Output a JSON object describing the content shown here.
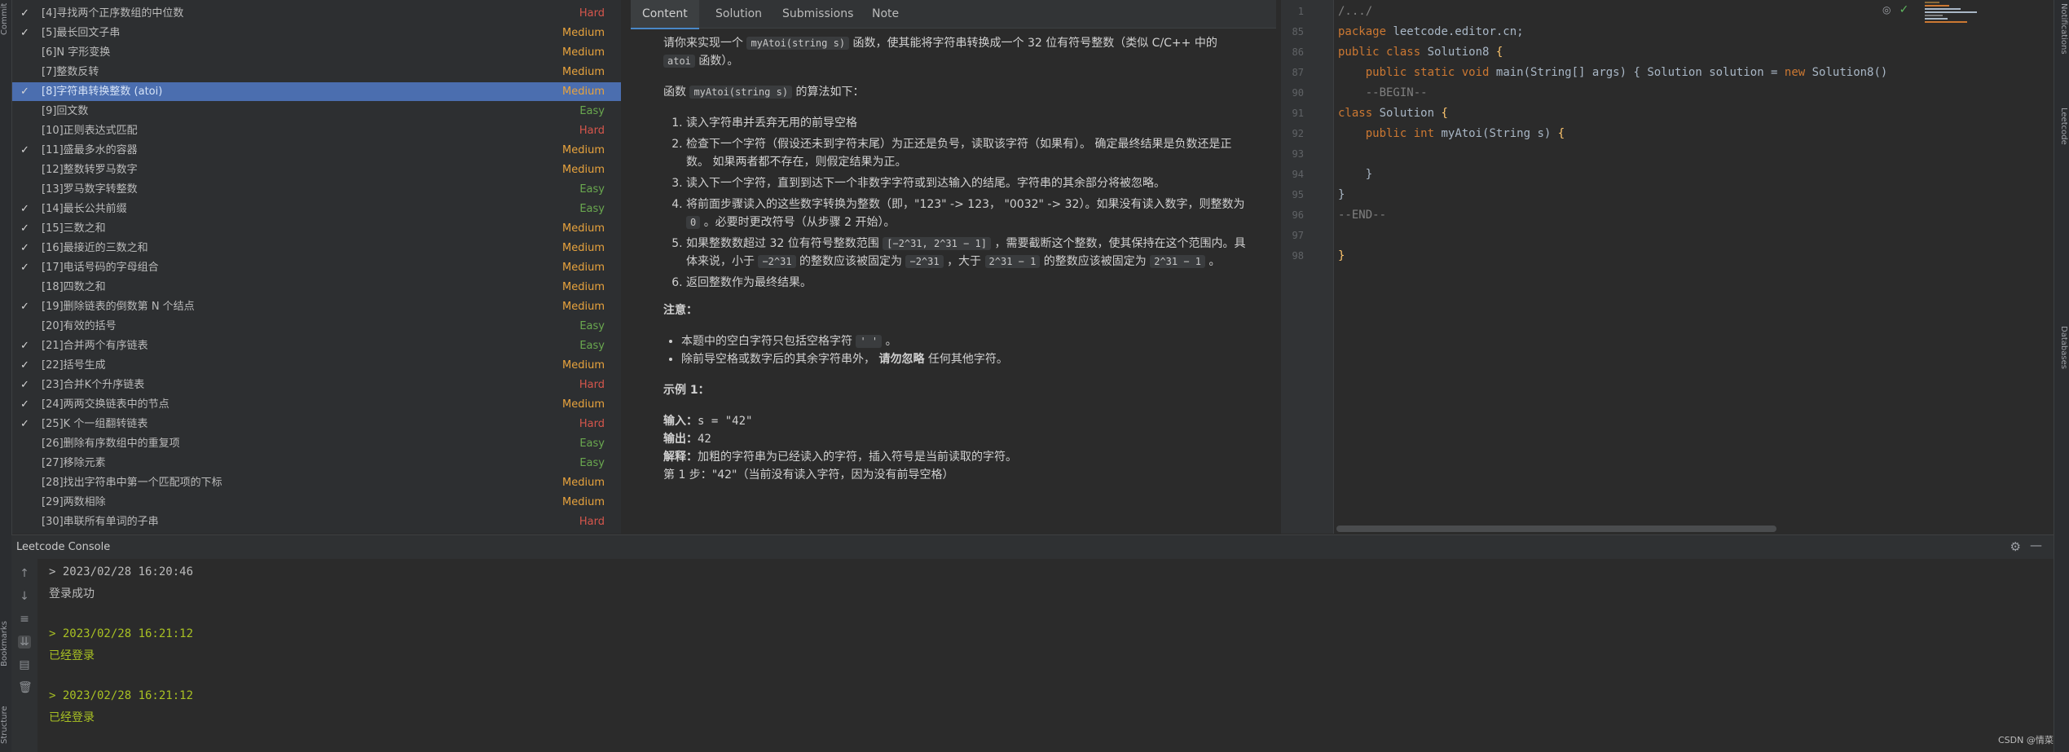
{
  "left_strip": {
    "labels": [
      "Commit",
      "Bookmarks",
      "Structure"
    ]
  },
  "right_strip": {
    "labels": [
      "Notifications",
      "Leetcode",
      "Databases"
    ]
  },
  "problems": [
    {
      "check": "✓",
      "title": "[4]寻找两个正序数组的中位数",
      "difficulty": "Hard",
      "level": "hard"
    },
    {
      "check": "✓",
      "title": "[5]最长回文子串",
      "difficulty": "Medium",
      "level": "medium"
    },
    {
      "check": "",
      "title": "[6]N 字形变换",
      "difficulty": "Medium",
      "level": "medium"
    },
    {
      "check": "",
      "title": "[7]整数反转",
      "difficulty": "Medium",
      "level": "medium"
    },
    {
      "check": "✓",
      "title": "[8]字符串转换整数 (atoi)",
      "difficulty": "Medium",
      "level": "medium",
      "selected": true
    },
    {
      "check": "",
      "title": "[9]回文数",
      "difficulty": "Easy",
      "level": "easy"
    },
    {
      "check": "",
      "title": "[10]正则表达式匹配",
      "difficulty": "Hard",
      "level": "hard"
    },
    {
      "check": "✓",
      "title": "[11]盛最多水的容器",
      "difficulty": "Medium",
      "level": "medium"
    },
    {
      "check": "",
      "title": "[12]整数转罗马数字",
      "difficulty": "Medium",
      "level": "medium"
    },
    {
      "check": "",
      "title": "[13]罗马数字转整数",
      "difficulty": "Easy",
      "level": "easy"
    },
    {
      "check": "✓",
      "title": "[14]最长公共前缀",
      "difficulty": "Easy",
      "level": "easy"
    },
    {
      "check": "✓",
      "title": "[15]三数之和",
      "difficulty": "Medium",
      "level": "medium"
    },
    {
      "check": "✓",
      "title": "[16]最接近的三数之和",
      "difficulty": "Medium",
      "level": "medium"
    },
    {
      "check": "✓",
      "title": "[17]电话号码的字母组合",
      "difficulty": "Medium",
      "level": "medium"
    },
    {
      "check": "",
      "title": "[18]四数之和",
      "difficulty": "Medium",
      "level": "medium"
    },
    {
      "check": "✓",
      "title": "[19]删除链表的倒数第 N 个结点",
      "difficulty": "Medium",
      "level": "medium"
    },
    {
      "check": "",
      "title": "[20]有效的括号",
      "difficulty": "Easy",
      "level": "easy"
    },
    {
      "check": "✓",
      "title": "[21]合并两个有序链表",
      "difficulty": "Easy",
      "level": "easy"
    },
    {
      "check": "✓",
      "title": "[22]括号生成",
      "difficulty": "Medium",
      "level": "medium"
    },
    {
      "check": "✓",
      "title": "[23]合并K个升序链表",
      "difficulty": "Hard",
      "level": "hard"
    },
    {
      "check": "✓",
      "title": "[24]两两交换链表中的节点",
      "difficulty": "Medium",
      "level": "medium"
    },
    {
      "check": "✓",
      "title": "[25]K 个一组翻转链表",
      "difficulty": "Hard",
      "level": "hard"
    },
    {
      "check": "",
      "title": "[26]删除有序数组中的重复项",
      "difficulty": "Easy",
      "level": "easy"
    },
    {
      "check": "",
      "title": "[27]移除元素",
      "difficulty": "Easy",
      "level": "easy"
    },
    {
      "check": "",
      "title": "[28]找出字符串中第一个匹配项的下标",
      "difficulty": "Medium",
      "level": "medium"
    },
    {
      "check": "",
      "title": "[29]两数相除",
      "difficulty": "Medium",
      "level": "medium"
    },
    {
      "check": "",
      "title": "[30]串联所有单词的子串",
      "difficulty": "Hard",
      "level": "hard"
    }
  ],
  "tabs": [
    "Content",
    "Solution",
    "Submissions",
    "Note"
  ],
  "description": {
    "intro_a": "请你来实现一个",
    "func": "myAtoi(string s)",
    "intro_b": "函数，使其能将字符串转换成一个 32 位有符号整数（类似 C/C++ 中的",
    "atoi": "atoi",
    "intro_c": "函数）。",
    "algo_a": "函数",
    "algo_b": "的算法如下：",
    "step1": "读入字符串并丢弃无用的前导空格",
    "step2": "检查下一个字符（假设还未到字符末尾）为正还是负号，读取该字符（如果有）。 确定最终结果是负数还是正数。 如果两者都不存在，则假定结果为正。",
    "step3": "读入下一个字符，直到到达下一个非数字字符或到达输入的结尾。字符串的其余部分将被忽略。",
    "step4a": "将前面步骤读入的这些数字转换为整数（即，\"123\" -> 123， \"0032\" -> 32）。如果没有读入数字，则整数为",
    "step4_zero": "0",
    "step4b": "。必要时更改符号（从步骤 2 开始）。",
    "step5a": "如果整数数超过 32 位有符号整数范围",
    "step5_range": "[−2^31, 2^31 − 1]",
    "step5b": "，需要截断这个整数，使其保持在这个范围内。具体来说，小于",
    "step5_min": "−2^31",
    "step5c": "的整数应该被固定为",
    "step5_min2": "−2^31",
    "step5d": "，大于",
    "step5_max": "2^31 − 1",
    "step5e": "的整数应该被固定为",
    "step5_max2": "2^31 − 1",
    "step5f": "。",
    "step6": "返回整数作为最终结果。",
    "note_title": "注意：",
    "note1a": "本题中的空白字符只包括空格字符",
    "note1_code": "' '",
    "note1b": "。",
    "note2a": "除前导空格或数字后的其余字符串外，",
    "note2_bold": "请勿忽略",
    "note2b": " 任何其他字符。",
    "example_title": "示例 1：",
    "input_label": "输入：",
    "input_value": "s = \"42\"",
    "output_label": "输出：",
    "output_value": "42",
    "explain_label": "解释：",
    "explain_value": "加粗的字符串为已经读入的字符，插入符号是当前读取的字符。",
    "step_line": "第 1 步：\"42\"（当前没有读入字符，因为没有前导空格）"
  },
  "editor": {
    "line_numbers": [
      "1",
      "85",
      "86",
      "87",
      "90",
      "91",
      "92",
      "93",
      "94",
      "95",
      "96",
      "97",
      "98"
    ],
    "lines": [
      "/.../",
      "package leetcode.editor.cn;",
      "public class Solution8 {",
      "    public static void main(String[] args) { Solution solution = new Solution8()",
      "    --BEGIN--",
      "class Solution {",
      "    public int myAtoi(String s) {",
      "",
      "    }",
      "}",
      "--END--",
      "",
      "}"
    ]
  },
  "console": {
    "title": "Leetcode Console",
    "lines": [
      {
        "text": "> 2023/02/28 16:20:46",
        "style": "plain-mono"
      },
      {
        "text": "登录成功",
        "style": "plain"
      },
      {
        "text": "> 2023/02/28 16:21:12",
        "style": "green"
      },
      {
        "text": "已经登录",
        "style": "ok"
      },
      {
        "text": "> 2023/02/28 16:21:12",
        "style": "green"
      },
      {
        "text": "已经登录",
        "style": "ok"
      }
    ]
  },
  "watermark": "CSDN @情菜",
  "colors": {
    "accent": "#4b6eaf",
    "hard": "#d5564c",
    "medium": "#e8a33d",
    "easy": "#6aa84f"
  }
}
